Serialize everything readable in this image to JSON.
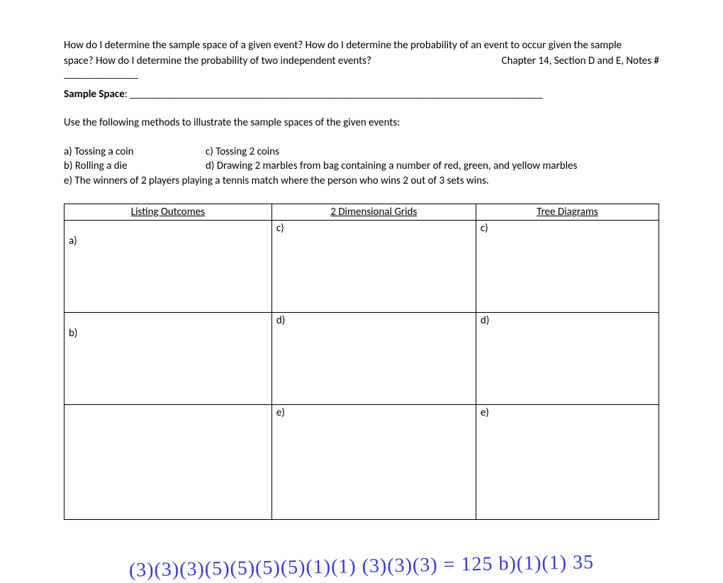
{
  "intro": {
    "line1": "How do I determine the sample space of a given event?  How do I determine the probability of an event to occur given the sample",
    "line2_left": "space?  How do I determine the probability of two independent events?",
    "line2_right": "Chapter 14, Section D and E, Notes #",
    "underline": "______________"
  },
  "sample_space": {
    "label": "Sample Space",
    "colon_line": ": ______________________________________________________________________________"
  },
  "methods_text": "Use the following methods to illustrate the sample spaces of the given events:",
  "options": {
    "a": "a) Tossing a coin",
    "c": "c)  Tossing 2 coins",
    "b": "b)  Rolling a die",
    "d": "d)  Drawing 2 marbles from bag containing a number of red, green, and yellow marbles",
    "e": "e)  The winners of 2 players playing a tennis match where the person who wins 2 out of 3 sets wins."
  },
  "table": {
    "headers": {
      "col1": "Listing Outcomes",
      "col2": "2 Dimensional Grids",
      "col3": "Tree Diagrams"
    },
    "cells": {
      "r1c1": "a)",
      "r1c2": "c)",
      "r1c3": "c)",
      "r2c1": "b)",
      "r2c2": "d)",
      "r2c3": "d)",
      "r3c1": "",
      "r3c2": "e)",
      "r3c3": "e)"
    }
  },
  "handwriting": "(3)(3)(3)(5)(5)(5)(5)(1)(1)    (3)(3)(3)  =  125  b)(1)(1) 35"
}
